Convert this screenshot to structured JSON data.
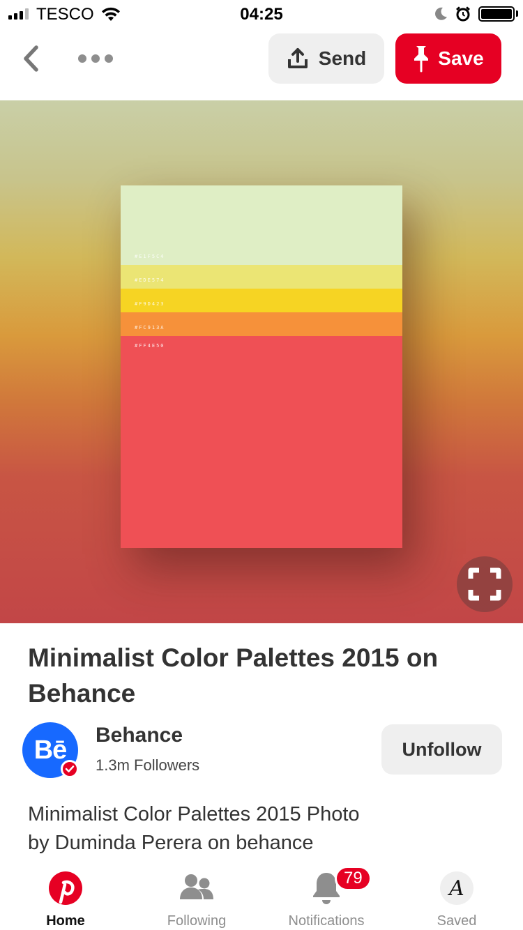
{
  "status_bar": {
    "carrier": "TESCO",
    "time": "04:25",
    "battery_level": 1.0
  },
  "nav": {
    "back_icon": "chevron-left-icon",
    "more_icon": "more-dots-icon",
    "send_label": "Send",
    "send_icon": "share-upload-icon",
    "save_label": "Save",
    "save_icon": "pushpin-icon"
  },
  "pin": {
    "palette": [
      {
        "code": "#E1F5C4",
        "color": "#dfeec5"
      },
      {
        "code": "#EDE574",
        "color": "#ebe574"
      },
      {
        "code": "#F9D423",
        "color": "#f6d423"
      },
      {
        "code": "#FC913A",
        "color": "#f6913a"
      },
      {
        "code": "#FF4E50",
        "color": "#ef5055"
      }
    ],
    "palette_share": [
      0.22,
      0.065,
      0.065,
      0.065,
      0.585
    ],
    "expand_icon": "expand-icon",
    "title": "Minimalist Color Palettes 2015 on Behance"
  },
  "creator": {
    "avatar_text": "Bē",
    "name": "Behance",
    "followers": "1.3m Followers",
    "follow_button": "Unfollow",
    "verified_icon": "verified-check-icon"
  },
  "description": "Minimalist Color Palettes 2015 Photo by Duminda Perera on behance",
  "tabs": [
    {
      "label": "Home",
      "icon": "pinterest-logo-icon",
      "active": true
    },
    {
      "label": "Following",
      "icon": "people-icon",
      "active": false
    },
    {
      "label": "Notifications",
      "icon": "bell-icon",
      "active": false,
      "badge": "79"
    },
    {
      "label": "Saved",
      "icon": "profile-avatar-icon",
      "active": false,
      "avatar_text": "A"
    }
  ],
  "colors": {
    "brand_red": "#e60023",
    "behance_blue": "#1769ff",
    "button_gray": "#efefef"
  }
}
